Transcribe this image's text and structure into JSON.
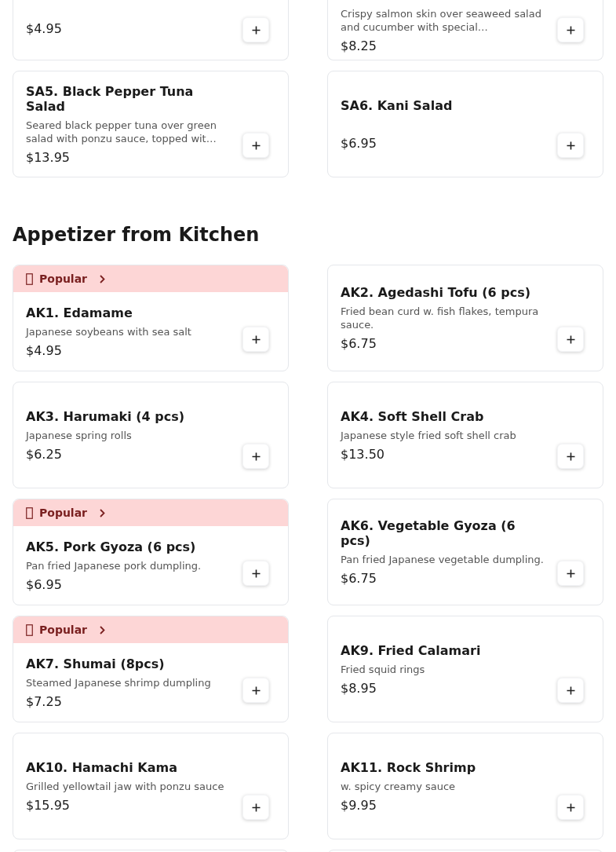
{
  "partial_items": [
    {
      "price": "$4.95"
    },
    {
      "description": "Crispy salmon skin over seaweed salad and cucumber with special…",
      "price": "$8.25"
    }
  ],
  "items": [
    {
      "title": "SA5. Black Pepper Tuna Salad",
      "description": "Seared black pepper tuna over green salad with ponzu sauce, topped wit…",
      "price": "$13.95"
    },
    {
      "title": "SA6. Kani Salad",
      "price": "$6.95"
    }
  ],
  "section": {
    "title": "Appetizer from Kitchen",
    "items": [
      {
        "badge": "Popular",
        "title": "AK1. Edamame",
        "description": "Japanese soybeans with sea salt",
        "price": "$4.95"
      },
      {
        "title": "AK2. Agedashi Tofu (6 pcs)",
        "description": "Fried bean curd w. fish flakes, tempura sauce.",
        "price": "$6.75"
      },
      {
        "title": "AK3. Harumaki (4 pcs)",
        "description": "Japanese spring rolls",
        "price": "$6.25"
      },
      {
        "title": "AK4. Soft Shell Crab",
        "description": "Japanese style fried soft shell crab",
        "price": "$13.50"
      },
      {
        "badge": "Popular",
        "title": "AK5. Pork Gyoza (6 pcs)",
        "description": "Pan fried Japanese pork dumpling.",
        "price": "$6.95"
      },
      {
        "title": "AK6. Vegetable Gyoza (6 pcs)",
        "description": "Pan fried Japanese vegetable dumpling.",
        "price": "$6.75"
      },
      {
        "badge": "Popular",
        "title": "AK7. Shumai (8pcs)",
        "description": "Steamed Japanese shrimp dumpling",
        "price": "$7.25"
      },
      {
        "title": "AK9. Fried Calamari",
        "description": "Fried squid rings",
        "price": "$8.95"
      },
      {
        "title": "AK10. Hamachi Kama",
        "description": "Grilled yellowtail jaw with ponzu sauce",
        "price": "$15.95"
      },
      {
        "title": "AK11. Rock Shrimp",
        "description": "w. spicy creamy sauce",
        "price": "$9.95"
      }
    ]
  }
}
